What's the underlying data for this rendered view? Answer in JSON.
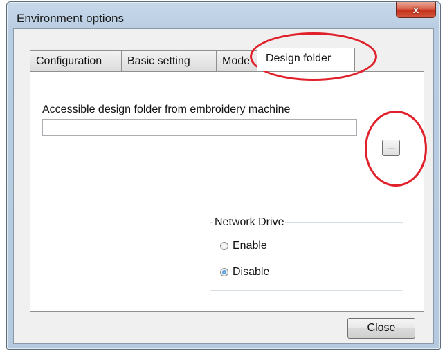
{
  "window": {
    "title": "Environment options",
    "close_glyph": "x"
  },
  "tabs": [
    {
      "label": "Configuration",
      "active": false
    },
    {
      "label": "Basic setting",
      "active": false
    },
    {
      "label": "Mode",
      "active": false
    },
    {
      "label": "Design folder",
      "active": true
    }
  ],
  "design_folder": {
    "label": "Accessible design folder from embroidery machine",
    "path_value": "",
    "browse_label": "..."
  },
  "network_drive": {
    "title": "Network Drive",
    "options": [
      {
        "label": "Enable",
        "checked": false
      },
      {
        "label": "Disable",
        "checked": true
      }
    ]
  },
  "buttons": {
    "close_label": "Close"
  },
  "colors": {
    "highlight": "#e0202a",
    "title_bar": "#c7d8ea",
    "close_button": "#c4321b"
  }
}
